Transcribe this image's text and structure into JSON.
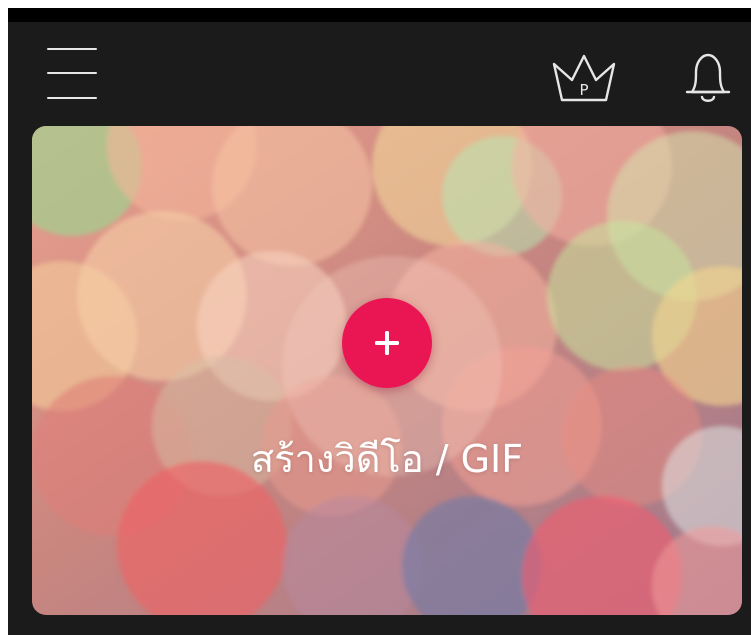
{
  "top_bar": {
    "menu_icon": "hamburger-menu-icon",
    "premium_icon": "crown-icon",
    "premium_badge_letter": "P",
    "notifications_icon": "bell-icon"
  },
  "hero": {
    "add_icon": "plus-icon",
    "create_label": "สร้างวิดีโอ / GIF",
    "background": "bokeh-image"
  },
  "colors": {
    "app_background": "#1b1b1b",
    "icon_color": "#e6e6e6",
    "accent": "#ea1654",
    "label_text": "#ffffff"
  }
}
